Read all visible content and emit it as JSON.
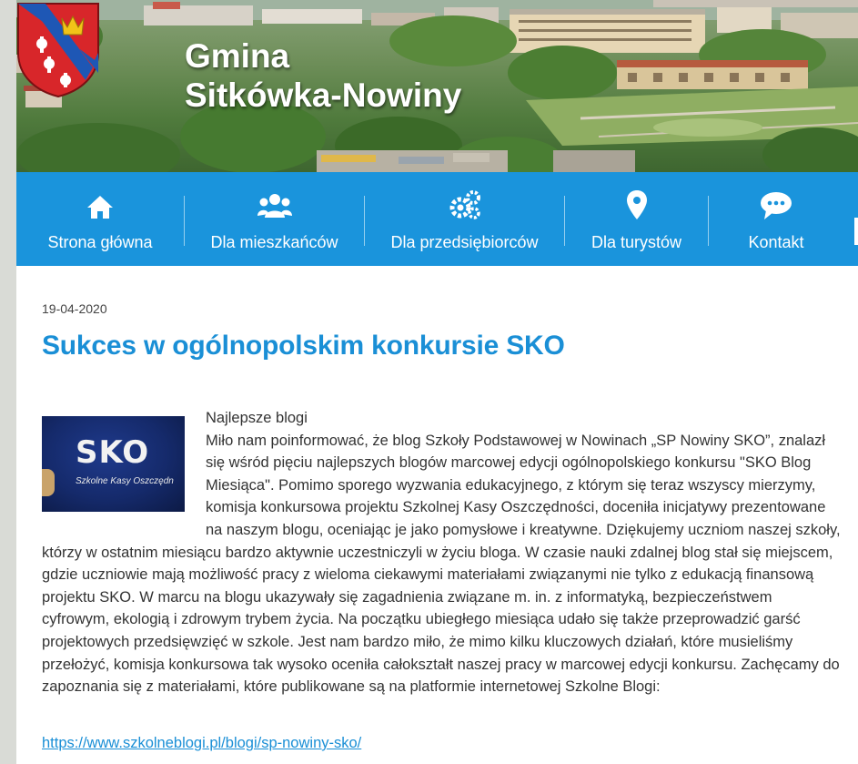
{
  "header": {
    "title_line1": "Gmina",
    "title_line2": "Sitkówka-Nowiny",
    "colors": {
      "nav_bg": "#1a94dc",
      "accent": "#1a8fd6",
      "crest_red": "#d8262a",
      "crest_blue": "#1e57b5",
      "crest_gold": "#f2c318"
    }
  },
  "nav": {
    "items": [
      {
        "label": "Strona główna",
        "icon": "home-icon"
      },
      {
        "label": "Dla mieszkańców",
        "icon": "users-icon"
      },
      {
        "label": "Dla przedsiębiorców",
        "icon": "cogs-icon"
      },
      {
        "label": "Dla turystów",
        "icon": "map-marker-icon"
      },
      {
        "label": "Kontakt",
        "icon": "chat-bubble-icon"
      }
    ]
  },
  "article": {
    "date": "19-04-2020",
    "title": "Sukces w ogólnopolskim konkursie SKO",
    "image": {
      "big_text": "SKO",
      "caption": "Szkolne Kasy Oszczędn"
    },
    "subheading": "Najlepsze blogi",
    "body": "Miło nam poinformować, że blog Szkoły Podstawowej w Nowinach „SP Nowiny SKO”, znalazł się wśród pięciu najlepszych blogów marcowej edycji ogólnopolskiego konkursu \"SKO Blog Miesiąca\". Pomimo sporego wyzwania edukacyjnego, z którym się teraz wszyscy mierzymy, komisja konkursowa projektu Szkolnej Kasy Oszczędności, doceniła inicjatywy prezentowane na naszym blogu, oceniając je jako pomysłowe i kreatywne. Dziękujemy uczniom naszej szkoły, którzy w ostatnim miesiącu bardzo aktywnie uczestniczyli w życiu bloga. W czasie nauki zdalnej blog stał się miejscem, gdzie uczniowie mają możliwość  pracy z wieloma ciekawymi materiałami związanymi nie tylko z edukacją finansową projektu SKO.  W marcu na blogu ukazywały się zagadnienia związane m. in. z informatyką, bezpieczeństwem cyfrowym, ekologią i zdrowym trybem życia. Na początku ubiegłego miesiąca udało się także przeprowadzić garść projektowych przedsięwzięć w szkole. Jest nam bardzo miło, że mimo kilku kluczowych działań, które musieliśmy przełożyć, komisja konkursowa tak wysoko oceniła całokształt naszej pracy w marcowej edycji konkursu. Zachęcamy do zapoznania się z materiałami, które publikowane są na platformie internetowej Szkolne Blogi:",
    "link": "https://www.szkolneblogi.pl/blogi/sp-nowiny-sko/"
  }
}
